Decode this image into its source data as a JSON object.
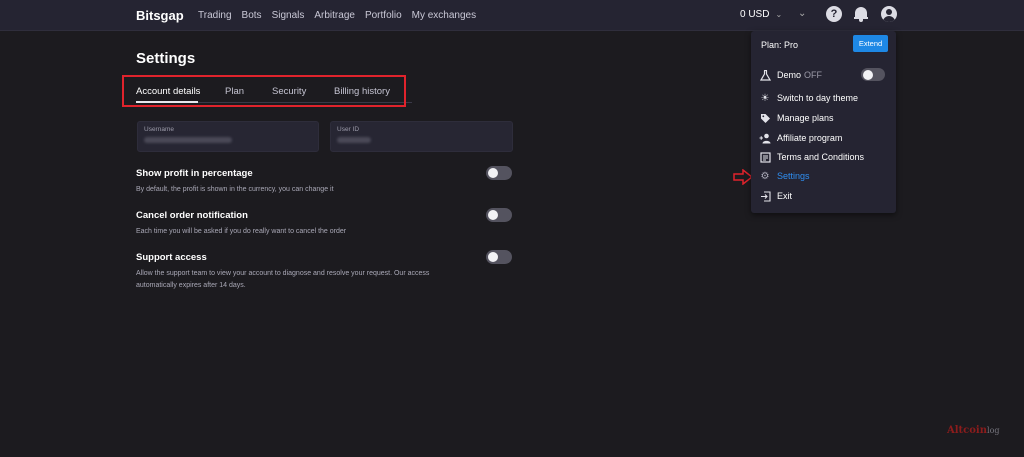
{
  "header": {
    "logo": "Bitsgap",
    "nav": [
      "Trading",
      "Bots",
      "Signals",
      "Arbitrage",
      "Portfolio",
      "My exchanges"
    ],
    "balance": "0 USD",
    "help_icon": "?"
  },
  "page": {
    "title": "Settings",
    "tabs": [
      "Account details",
      "Plan",
      "Security",
      "Billing history"
    ],
    "active_tab": "Account details"
  },
  "fields": {
    "username_label": "Username",
    "userid_label": "User ID"
  },
  "settings": [
    {
      "name": "Show profit in percentage",
      "desc": "By default, the profit is shown in the currency, you can change it",
      "enabled": false
    },
    {
      "name": "Cancel order notification",
      "desc": "Each time you will be asked if you do really want to cancel the order",
      "enabled": false
    },
    {
      "name": "Support access",
      "desc": "Allow the support team to view your account to diagnose and resolve your request. Our access automatically expires after 14 days.",
      "enabled": false
    }
  ],
  "dropdown": {
    "plan": "Plan: Pro",
    "extend": "Extend",
    "demo": "Demo",
    "demo_state": "OFF",
    "items": [
      "Switch to day theme",
      "Manage plans",
      "Affiliate program",
      "Terms and Conditions",
      "Settings",
      "Exit"
    ],
    "active_item": "Settings"
  },
  "watermark": {
    "brand": "Altcoin",
    "suffix": "log"
  },
  "colors": {
    "accent": "#1e88e5",
    "highlight_box": "#e0232c",
    "active_link": "#2f8ef0"
  }
}
